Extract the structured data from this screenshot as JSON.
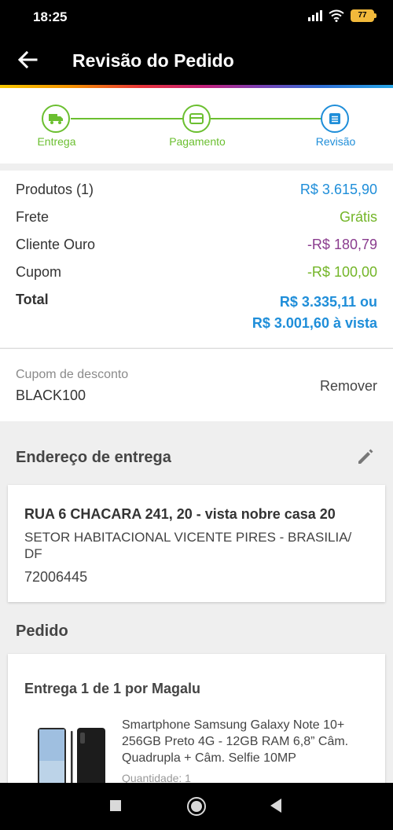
{
  "status_bar": {
    "time": "18:25",
    "battery": "77"
  },
  "header": {
    "title": "Revisão do Pedido"
  },
  "colors": {
    "accent_green": "#6bbf30",
    "accent_blue": "#1f8ed9",
    "purple": "#8a3c8e"
  },
  "stepper": {
    "steps": [
      {
        "label": "Entrega",
        "icon": "truck-icon",
        "state": "done"
      },
      {
        "label": "Pagamento",
        "icon": "card-icon",
        "state": "done"
      },
      {
        "label": "Revisão",
        "icon": "document-icon",
        "state": "current"
      }
    ]
  },
  "summary": {
    "products_label": "Produtos (1)",
    "products_value": "R$ 3.615,90",
    "shipping_label": "Frete",
    "shipping_value": "Grátis",
    "gold_label": "Cliente Ouro",
    "gold_value": "-R$ 180,79",
    "coupon_label": "Cupom",
    "coupon_value": "-R$ 100,00",
    "total_label": "Total",
    "total_value_1": "R$ 3.335,11 ou",
    "total_value_2": "R$ 3.001,60 à vista"
  },
  "coupon": {
    "label": "Cupom de desconto",
    "code": "BLACK100",
    "remove_label": "Remover"
  },
  "address": {
    "section_title": "Endereço de entrega",
    "line1": "RUA 6 CHACARA 241, 20 - vista nobre casa 20",
    "line2": "SETOR HABITACIONAL VICENTE PIRES - BRASILIA/ DF",
    "zip": "72006445"
  },
  "order": {
    "section_title": "Pedido",
    "shipment": "Entrega 1 de 1 por Magalu",
    "product_name": "Smartphone Samsung Galaxy Note 10+ 256GB Preto 4G - 12GB RAM 6,8” Câm. Quadrupla + Câm. Selfie 10MP",
    "quantity": "Quantidade: 1"
  }
}
